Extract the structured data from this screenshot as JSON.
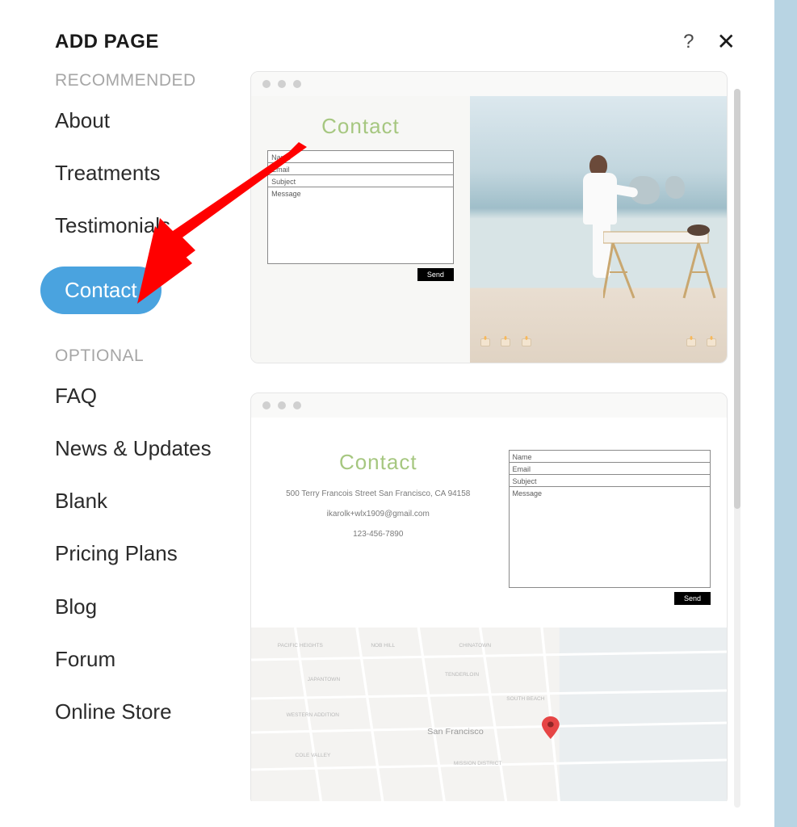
{
  "header": {
    "title": "ADD PAGE",
    "help_icon": "help-icon",
    "close_icon": "close-icon"
  },
  "sidebar": {
    "sections": [
      {
        "label": "RECOMMENDED",
        "items": [
          {
            "label": "About",
            "selected": false
          },
          {
            "label": "Treatments",
            "selected": false
          },
          {
            "label": "Testimonials",
            "selected": false
          },
          {
            "label": "Contact",
            "selected": true
          }
        ]
      },
      {
        "label": "OPTIONAL",
        "items": [
          {
            "label": "FAQ",
            "selected": false
          },
          {
            "label": "News & Updates",
            "selected": false
          },
          {
            "label": "Blank",
            "selected": false
          },
          {
            "label": "Pricing Plans",
            "selected": false
          },
          {
            "label": "Blog",
            "selected": false
          },
          {
            "label": "Forum",
            "selected": false
          },
          {
            "label": "Online Store",
            "selected": false
          }
        ]
      }
    ]
  },
  "previews": {
    "template1": {
      "title": "Contact",
      "fields": {
        "name": "Name",
        "email": "Email",
        "subject": "Subject",
        "message": "Message"
      },
      "send": "Send"
    },
    "template2": {
      "title": "Contact",
      "address": "500 Terry Francois Street San Francisco, CA 94158",
      "email": "ikarolk+wlx1909@gmail.com",
      "phone": "123-456-7890",
      "fields": {
        "name": "Name",
        "email": "Email",
        "subject": "Subject",
        "message": "Message"
      },
      "send": "Send",
      "map_city": "San Francisco"
    }
  },
  "annotation": {
    "type": "red-arrow",
    "points_to": "sidebar-item-contact"
  }
}
